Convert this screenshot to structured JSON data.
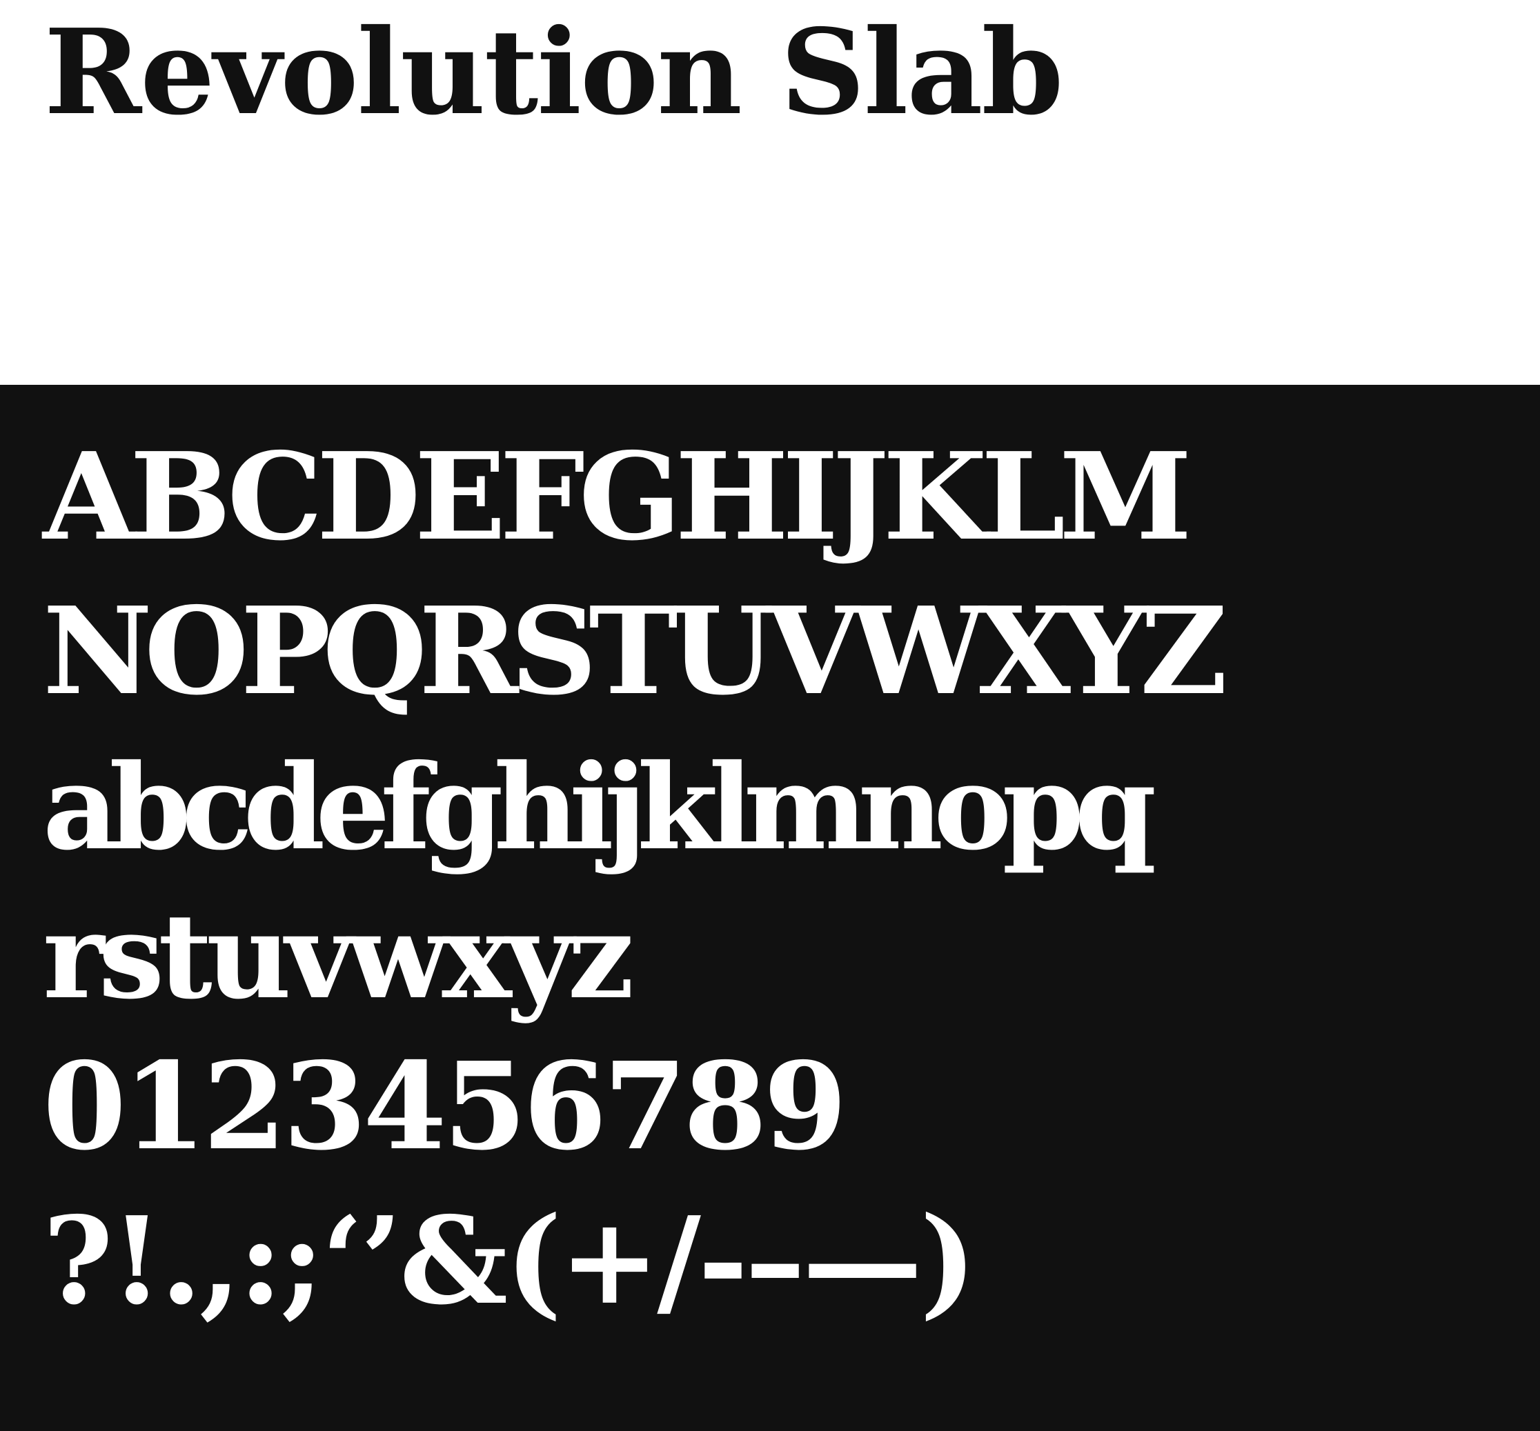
{
  "title": "Revolution Slab",
  "colors": {
    "page_background": "#ffffff",
    "title_text": "#111111",
    "panel_background": "#111111",
    "glyph_text": "#ffffff"
  },
  "specimen": {
    "uppercase_1": "ABCDEFGHIJKLM",
    "uppercase_2": "NOPQRSTUVWXYZ",
    "lowercase_1": "abcdefghijklmnopq",
    "lowercase_2": "rstuvwxyz",
    "digits": "0123456789",
    "punctuation": "?!.,:;‘’&(+/-–—)"
  }
}
